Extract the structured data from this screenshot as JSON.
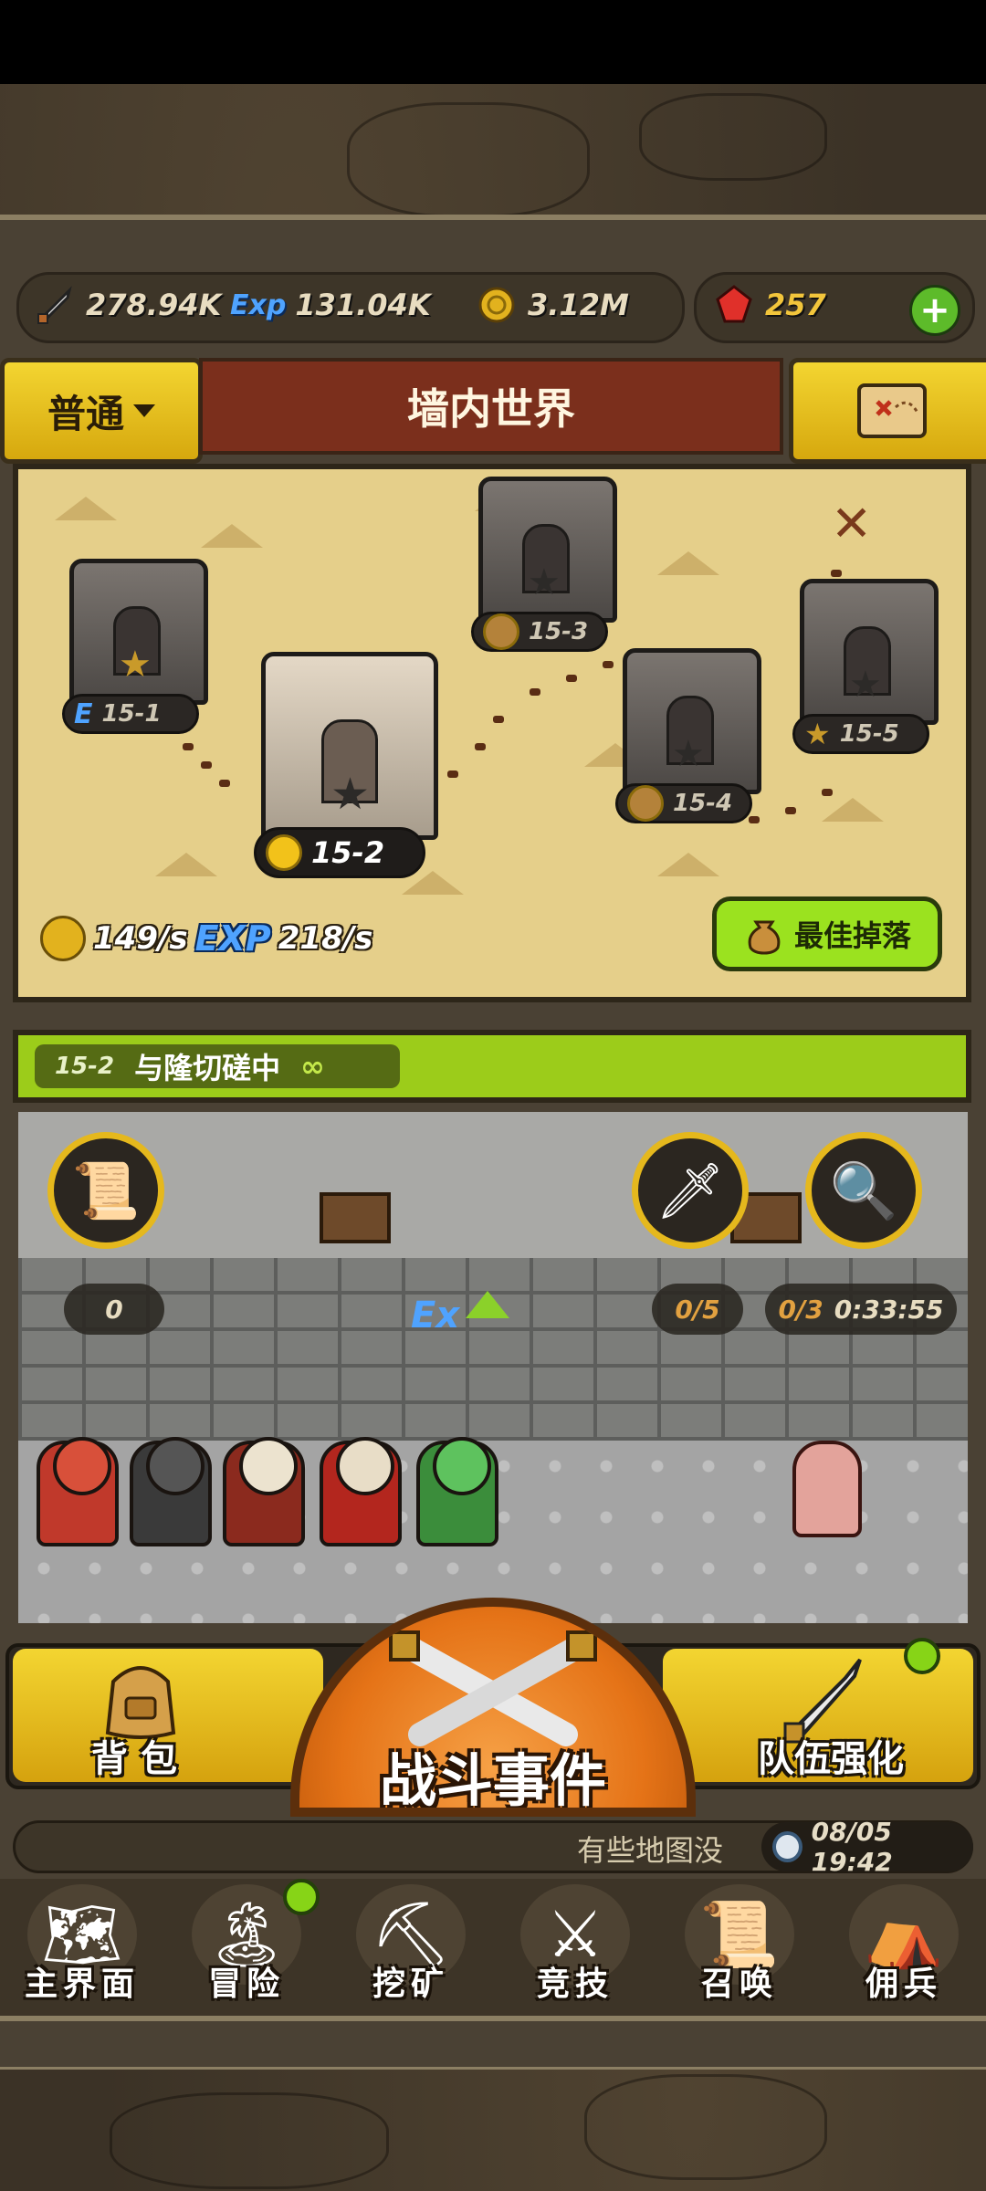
{
  "resources": {
    "attack": "278.94K",
    "exp": "131.04K",
    "gold": "3.12M",
    "gems": "257",
    "add_gems_label": "+"
  },
  "header": {
    "mode": "普通",
    "title": "墙内世界"
  },
  "map": {
    "stages": [
      {
        "label": "15-1",
        "badge": "E"
      },
      {
        "label": "15-2",
        "badge": "coin"
      },
      {
        "label": "15-3",
        "badge": "coin"
      },
      {
        "label": "15-4",
        "badge": "bag"
      },
      {
        "label": "15-5",
        "badge": "star"
      }
    ],
    "gold_rate": "149/s",
    "exp_label": "EXP",
    "exp_rate": "218/s",
    "best_drop": "最佳掉落"
  },
  "stage_strip": {
    "stage": "15-2",
    "status": "与隆切磋中",
    "infinity": "∞"
  },
  "battle": {
    "scroll_count": "0",
    "sword_count": "0/5",
    "search_count": "0/3",
    "search_timer": "0:33:55",
    "exp_boost_label": "Ex"
  },
  "actions": {
    "backpack": "背包",
    "battle_event": "战斗事件",
    "team_upgrade": "队伍强化"
  },
  "ticker": {
    "message": "有些地图没",
    "time": "08/05 19:42"
  },
  "nav": [
    {
      "label": "主界面",
      "icon": "map-scroll-icon"
    },
    {
      "label": "冒险",
      "icon": "island-icon"
    },
    {
      "label": "挖矿",
      "icon": "pickaxe-icon"
    },
    {
      "label": "竞技",
      "icon": "crossed-swords-icon"
    },
    {
      "label": "召唤",
      "icon": "summon-scroll-icon"
    },
    {
      "label": "佣兵",
      "icon": "tent-icon"
    }
  ],
  "colors": {
    "accent_yellow": "#f3d531",
    "banner_red": "#7b2f1c",
    "map_sand": "#e5cf8a",
    "strip_green": "#9ccc1a",
    "battle_orange": "#e57317"
  }
}
